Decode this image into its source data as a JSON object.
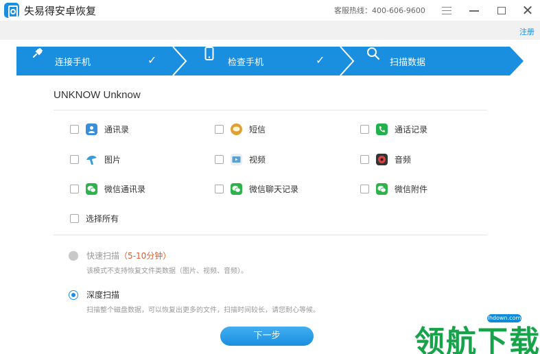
{
  "app": {
    "title": "失易得安卓恢复",
    "hotline": "客服热线：400-606-9600",
    "register": "注册",
    "logo_color": "#1a8fe0"
  },
  "steps": [
    {
      "label": "连接手机",
      "icon": "plug-icon",
      "done": true
    },
    {
      "label": "检查手机",
      "icon": "phone-icon",
      "done": true
    },
    {
      "label": "扫描数据",
      "icon": "search-icon",
      "done": false
    }
  ],
  "device": {
    "name": "UNKNOW Unknow"
  },
  "data_types": [
    {
      "label": "通讯录",
      "icon": "contacts-icon",
      "color": "#3b8fd9",
      "checked": false
    },
    {
      "label": "短信",
      "icon": "sms-icon",
      "color": "#e0a030",
      "checked": false
    },
    {
      "label": "通话记录",
      "icon": "call-log-icon",
      "color": "#22b14c",
      "checked": false
    },
    {
      "label": "图片",
      "icon": "photo-icon",
      "color": "#3a9bd6",
      "checked": false
    },
    {
      "label": "视频",
      "icon": "video-icon",
      "color": "#5aa0d0",
      "checked": false
    },
    {
      "label": "音频",
      "icon": "audio-icon",
      "color": "#d94040",
      "checked": false
    },
    {
      "label": "微信通讯录",
      "icon": "wechat-icon",
      "color": "#2db34a",
      "checked": false
    },
    {
      "label": "微信聊天记录",
      "icon": "wechat-icon",
      "color": "#2db34a",
      "checked": false
    },
    {
      "label": "微信附件",
      "icon": "wechat-icon",
      "color": "#2db34a",
      "checked": false
    }
  ],
  "select_all": {
    "label": "选择所有",
    "checked": false
  },
  "scan_modes": [
    {
      "title": "快速扫描",
      "duration": "（5-10分钟）",
      "desc": "该模式不支持恢复文件类数据（图片、视频、音频）。",
      "selected": false,
      "disabled": true
    },
    {
      "title": "深度扫描",
      "duration": "",
      "desc": "扫描整个磁盘数据，可以恢复出更多的文件，扫描时间较长，请您耐心等候。",
      "selected": true,
      "disabled": false
    }
  ],
  "next_button": "下一步",
  "watermark": {
    "text": "领航下载",
    "domain": "lhdown.com"
  },
  "colors": {
    "accent": "#1a8fe0",
    "warning": "#e05a2a",
    "watermark": "#16a34a"
  }
}
